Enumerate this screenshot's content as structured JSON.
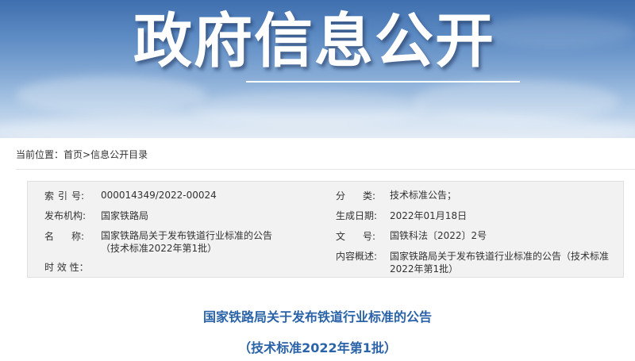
{
  "banner": {
    "title": "政府信息公开"
  },
  "breadcrumb": {
    "prefix": "当前位置：",
    "home": "首页",
    "separator": ">",
    "current": "信息公开目录"
  },
  "info": {
    "index_no": {
      "c1": "索",
      "c2": "引",
      "c3": "号:",
      "value": "000014349/2022-00024"
    },
    "category": {
      "c1": "分",
      "c2": "类:",
      "value": "技术标准公告；"
    },
    "publisher": {
      "label": "发布机构:",
      "value": "国家铁路局"
    },
    "date": {
      "label": "生成日期:",
      "value": "2022年01月18日"
    },
    "name": {
      "c1": "名",
      "c2": "称:",
      "value_line1": "国家铁路局关于发布铁道行业标准的公告",
      "value_line2": "（技术标准2022年第1批）"
    },
    "doc_no": {
      "c1": "文",
      "c2": "号:",
      "value": "国铁科法〔2022〕2号"
    },
    "summary": {
      "label": "内容概述:",
      "value_line1": "国家铁路局关于发布铁道行业标准的公告（技术标准",
      "value_line2": "2022年第1批）"
    },
    "validity": {
      "label": "时 效 性："
    }
  },
  "document": {
    "title_line1": "国家铁路局关于发布铁道行业标准的公告",
    "title_line2": "（技术标准2022年第1批）"
  },
  "colors": {
    "title_blue": "#2a63a8",
    "panel_bg": "#f2f2f2"
  }
}
